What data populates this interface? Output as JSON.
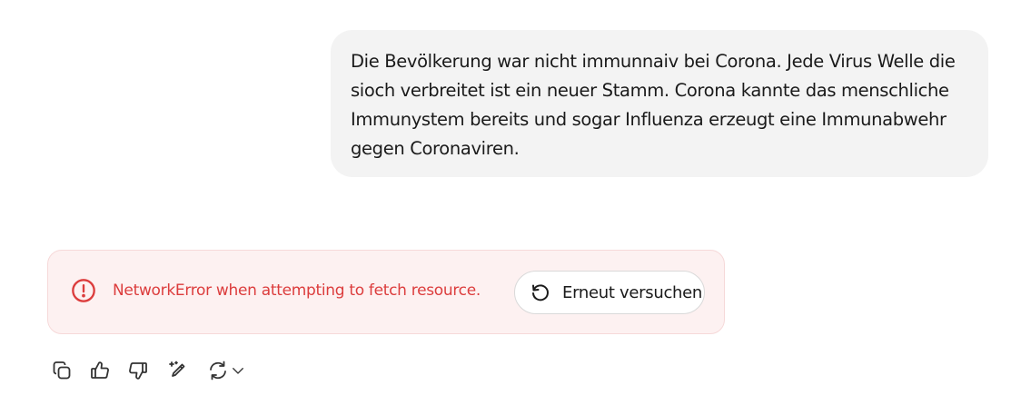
{
  "conversation": {
    "user_message": "Die Bevölkerung war nicht immunnaiv bei Corona. Jede Virus Welle die sioch verbreitet ist ein neuer Stamm. Corona kannte das menschliche Immunystem bereits und sogar Influenza erzeugt eine Immunabwehr gegen Coronaviren."
  },
  "error": {
    "message": "NetworkError when attempting to fetch resource.",
    "retry_label": "Erneut versuchen",
    "icon": "alert-circle-icon"
  },
  "actions": [
    {
      "name": "copy",
      "icon": "copy-icon"
    },
    {
      "name": "like",
      "icon": "thumbs-up-icon"
    },
    {
      "name": "dislike",
      "icon": "thumbs-down-icon"
    },
    {
      "name": "edit",
      "icon": "magic-pen-icon"
    },
    {
      "name": "regenerate",
      "icon": "refresh-icon"
    }
  ],
  "colors": {
    "bubble_bg": "#f3f3f3",
    "error_bg": "#fdf1f1",
    "error_text": "#dc3d3d",
    "icon": "#333333"
  }
}
